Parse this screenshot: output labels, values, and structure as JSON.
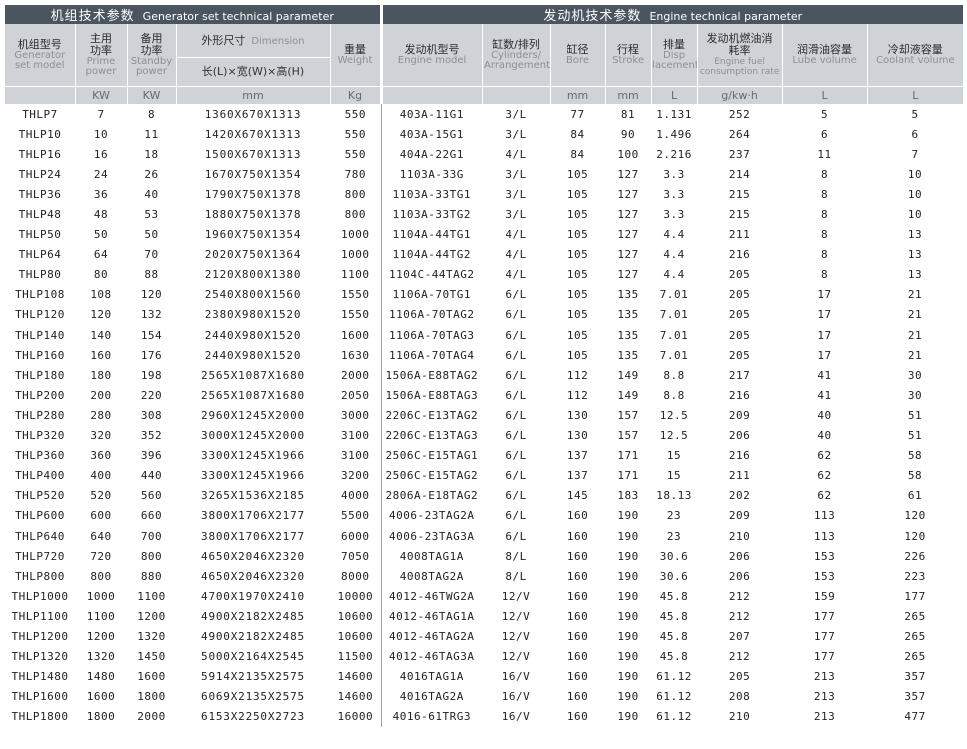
{
  "headers": {
    "group_left_zh": "机组技术参数",
    "group_left_en": "Generator set technical parameter",
    "group_right_zh": "发动机技术参数",
    "group_right_en": "Engine technical parameter",
    "model_zh": "机组型号",
    "model_en": "Generator set model",
    "prime_zh": "主用功率",
    "prime_en": "Prime power",
    "standby_zh": "备用功率",
    "standby_en": "Standby power",
    "dim_zh": "外形尺寸",
    "dim_en": "Dimension",
    "dim_sub": "长(L)×宽(W)×高(H)",
    "weight_zh": "重量",
    "weight_en": "Weight",
    "engine_zh": "发动机型号",
    "engine_en": "Engine model",
    "cyl_zh": "缸数/排列",
    "cyl_en": "Cylinders/ Arrangement",
    "bore_zh": "缸径",
    "bore_en": "Bore",
    "stroke_zh": "行程",
    "stroke_en": "Stroke",
    "disp_zh": "排量",
    "disp_en": "Disp lacement",
    "fuel_zh": "发动机燃油消耗率",
    "fuel_en": "Engine fuel consumption rate",
    "lube_zh": "润滑油容量",
    "lube_en": "Lube volume",
    "coolant_zh": "冷却液容量",
    "coolant_en": "Coolant volume"
  },
  "units": [
    "KW",
    "KW",
    "mm",
    "Kg",
    "mm",
    "mm",
    "L",
    "g/kw·h",
    "L",
    "L"
  ],
  "rows": [
    [
      "THLP7",
      "7",
      "8",
      "1360X670X1313",
      "550",
      "403A-11G1",
      "3/L",
      "77",
      "81",
      "1.131",
      "252",
      "5",
      "5"
    ],
    [
      "THLP10",
      "10",
      "11",
      "1420X670X1313",
      "550",
      "403A-15G1",
      "3/L",
      "84",
      "90",
      "1.496",
      "264",
      "6",
      "6"
    ],
    [
      "THLP16",
      "16",
      "18",
      "1500X670X1313",
      "550",
      "404A-22G1",
      "4/L",
      "84",
      "100",
      "2.216",
      "237",
      "11",
      "7"
    ],
    [
      "THLP24",
      "24",
      "26",
      "1670X750X1354",
      "780",
      "1103A-33G",
      "3/L",
      "105",
      "127",
      "3.3",
      "214",
      "8",
      "10"
    ],
    [
      "THLP36",
      "36",
      "40",
      "1790X750X1378",
      "800",
      "1103A-33TG1",
      "3/L",
      "105",
      "127",
      "3.3",
      "215",
      "8",
      "10"
    ],
    [
      "THLP48",
      "48",
      "53",
      "1880X750X1378",
      "800",
      "1103A-33TG2",
      "3/L",
      "105",
      "127",
      "3.3",
      "215",
      "8",
      "10"
    ],
    [
      "THLP50",
      "50",
      "50",
      "1960X750X1354",
      "1000",
      "1104A-44TG1",
      "4/L",
      "105",
      "127",
      "4.4",
      "211",
      "8",
      "13"
    ],
    [
      "THLP64",
      "64",
      "70",
      "2020X750X1364",
      "1000",
      "1104A-44TG2",
      "4/L",
      "105",
      "127",
      "4.4",
      "216",
      "8",
      "13"
    ],
    [
      "THLP80",
      "80",
      "88",
      "2120X800X1380",
      "1100",
      "1104C-44TAG2",
      "4/L",
      "105",
      "127",
      "4.4",
      "205",
      "8",
      "13"
    ],
    [
      "THLP108",
      "108",
      "120",
      "2540X800X1560",
      "1550",
      "1106A-70TG1",
      "6/L",
      "105",
      "135",
      "7.01",
      "205",
      "17",
      "21"
    ],
    [
      "THLP120",
      "120",
      "132",
      "2380X980X1520",
      "1550",
      "1106A-70TAG2",
      "6/L",
      "105",
      "135",
      "7.01",
      "205",
      "17",
      "21"
    ],
    [
      "THLP140",
      "140",
      "154",
      "2440X980X1520",
      "1600",
      "1106A-70TAG3",
      "6/L",
      "105",
      "135",
      "7.01",
      "205",
      "17",
      "21"
    ],
    [
      "THLP160",
      "160",
      "176",
      "2440X980X1520",
      "1630",
      "1106A-70TAG4",
      "6/L",
      "105",
      "135",
      "7.01",
      "205",
      "17",
      "21"
    ],
    [
      "THLP180",
      "180",
      "198",
      "2565X1087X1680",
      "2000",
      "1506A-E88TAG2",
      "6/L",
      "112",
      "149",
      "8.8",
      "217",
      "41",
      "30"
    ],
    [
      "THLP200",
      "200",
      "220",
      "2565X1087X1680",
      "2050",
      "1506A-E88TAG3",
      "6/L",
      "112",
      "149",
      "8.8",
      "216",
      "41",
      "30"
    ],
    [
      "THLP280",
      "280",
      "308",
      "2960X1245X2000",
      "3000",
      "2206C-E13TAG2",
      "6/L",
      "130",
      "157",
      "12.5",
      "209",
      "40",
      "51"
    ],
    [
      "THLP320",
      "320",
      "352",
      "3000X1245X2000",
      "3100",
      "2206C-E13TAG3",
      "6/L",
      "130",
      "157",
      "12.5",
      "206",
      "40",
      "51"
    ],
    [
      "THLP360",
      "360",
      "396",
      "3300X1245X1966",
      "3100",
      "2506C-E15TAG1",
      "6/L",
      "137",
      "171",
      "15",
      "216",
      "62",
      "58"
    ],
    [
      "THLP400",
      "400",
      "440",
      "3300X1245X1966",
      "3200",
      "2506C-E15TAG2",
      "6/L",
      "137",
      "171",
      "15",
      "211",
      "62",
      "58"
    ],
    [
      "THLP520",
      "520",
      "560",
      "3265X1536X2185",
      "4000",
      "2806A-E18TAG2",
      "6/L",
      "145",
      "183",
      "18.13",
      "202",
      "62",
      "61"
    ],
    [
      "THLP600",
      "600",
      "660",
      "3800X1706X2177",
      "5500",
      "4006-23TAG2A",
      "6/L",
      "160",
      "190",
      "23",
      "209",
      "113",
      "120"
    ],
    [
      "THLP640",
      "640",
      "700",
      "3800X1706X2177",
      "6000",
      "4006-23TAG3A",
      "6/L",
      "160",
      "190",
      "23",
      "210",
      "113",
      "120"
    ],
    [
      "THLP720",
      "720",
      "800",
      "4650X2046X2320",
      "7050",
      "4008TAG1A",
      "8/L",
      "160",
      "190",
      "30.6",
      "206",
      "153",
      "226"
    ],
    [
      "THLP800",
      "800",
      "880",
      "4650X2046X2320",
      "8000",
      "4008TAG2A",
      "8/L",
      "160",
      "190",
      "30.6",
      "206",
      "153",
      "223"
    ],
    [
      "THLP1000",
      "1000",
      "1100",
      "4700X1970X2410",
      "10000",
      "4012-46TWG2A",
      "12/V",
      "160",
      "190",
      "45.8",
      "212",
      "159",
      "177"
    ],
    [
      "THLP1100",
      "1100",
      "1200",
      "4900X2182X2485",
      "10600",
      "4012-46TAG1A",
      "12/V",
      "160",
      "190",
      "45.8",
      "212",
      "177",
      "265"
    ],
    [
      "THLP1200",
      "1200",
      "1320",
      "4900X2182X2485",
      "10600",
      "4012-46TAG2A",
      "12/V",
      "160",
      "190",
      "45.8",
      "207",
      "177",
      "265"
    ],
    [
      "THLP1320",
      "1320",
      "1450",
      "5000X2164X2545",
      "11500",
      "4012-46TAG3A",
      "12/V",
      "160",
      "190",
      "45.8",
      "212",
      "177",
      "265"
    ],
    [
      "THLP1480",
      "1480",
      "1600",
      "5914X2135X2575",
      "14600",
      "4016TAG1A",
      "16/V",
      "160",
      "190",
      "61.12",
      "205",
      "213",
      "357"
    ],
    [
      "THLP1600",
      "1600",
      "1800",
      "6069X2135X2575",
      "14600",
      "4016TAG2A",
      "16/V",
      "160",
      "190",
      "61.12",
      "208",
      "213",
      "357"
    ],
    [
      "THLP1800",
      "1800",
      "2000",
      "6153X2250X2723",
      "16000",
      "4016-61TRG3",
      "16/V",
      "160",
      "190",
      "61.12",
      "210",
      "213",
      "477"
    ]
  ]
}
